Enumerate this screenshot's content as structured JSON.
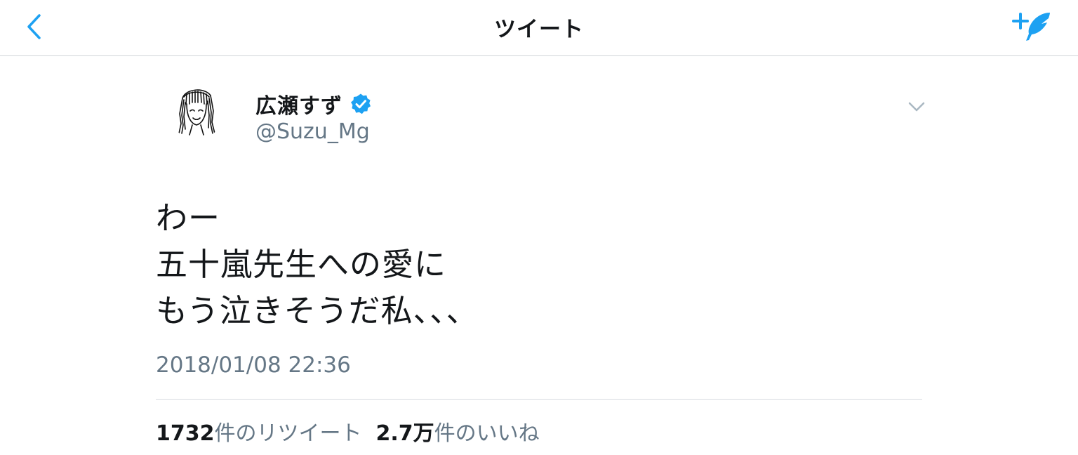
{
  "colors": {
    "accent": "#1da1f2",
    "text_primary": "#14171a",
    "text_secondary": "#657786",
    "divider": "#d6dbdf"
  },
  "navbar": {
    "title": "ツイート",
    "back_icon": "chevron-left-icon",
    "compose_icon": "compose-tweet-icon"
  },
  "tweet": {
    "author": {
      "display_name": "広瀬すず",
      "handle": "@Suzu_Mg",
      "verified": true
    },
    "text_lines": [
      "わー",
      "五十嵐先生への愛に",
      "もう泣きそうだ私、、、"
    ],
    "timestamp": "2018/01/08 22:36",
    "stats": {
      "retweets_count": "1732",
      "retweets_label": "件のリツイート",
      "likes_count": "2.7万",
      "likes_label": "件のいいね"
    }
  }
}
